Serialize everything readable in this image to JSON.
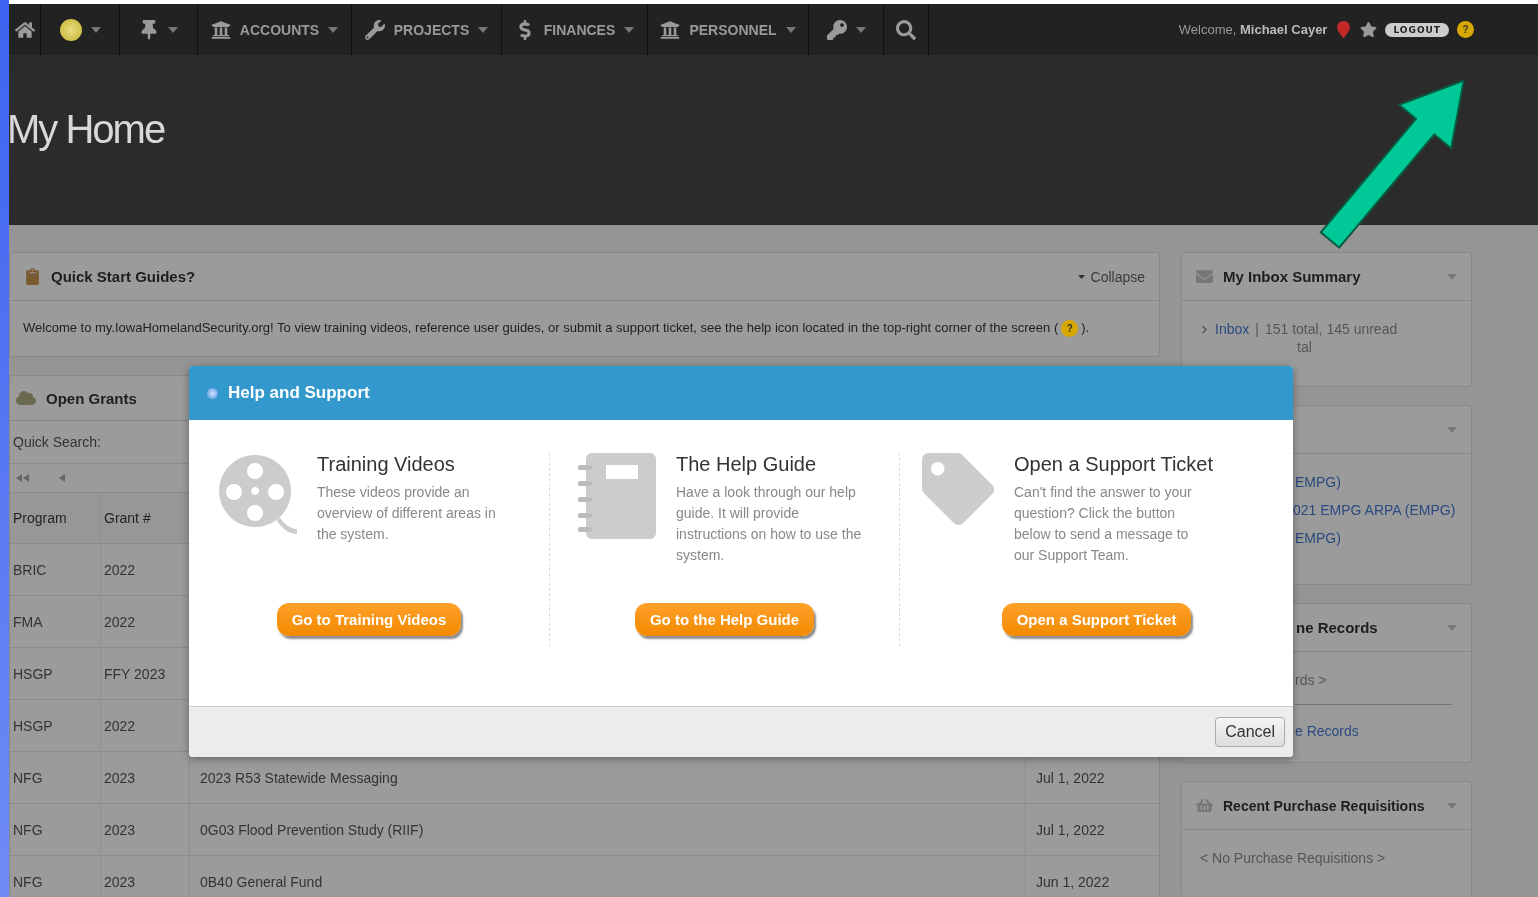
{
  "nav": {
    "items": [
      {
        "kind": "home"
      },
      {
        "kind": "status",
        "dropdown": true
      },
      {
        "kind": "pin",
        "dropdown": true
      },
      {
        "kind": "bank",
        "label": "ACCOUNTS",
        "dropdown": true
      },
      {
        "kind": "wrench",
        "label": "PROJECTS",
        "dropdown": true
      },
      {
        "kind": "dollar",
        "label": "FINANCES",
        "dropdown": true
      },
      {
        "kind": "bank",
        "label": "PERSONNEL",
        "dropdown": true
      },
      {
        "kind": "key",
        "dropdown": true
      },
      {
        "kind": "search"
      }
    ]
  },
  "user": {
    "greeting": "Welcome,",
    "name": "Michael Cayer",
    "logout": "LOGOUT",
    "help": "?"
  },
  "page_title": "My Home",
  "quick_start": {
    "title": "Quick Start Guides?",
    "toggle": "Collapse",
    "text": "Welcome to my.IowaHomelandSecurity.org! To view training videos, reference user guides, or submit a support ticket, see the help icon located in the top-right corner of the screen (",
    "help": "?",
    "text_end": ")."
  },
  "open_grants": {
    "title": "Open Grants",
    "search_label": "Quick Search:",
    "columns": [
      "Program",
      "Grant #"
    ],
    "rows": [
      {
        "program": "BRIC",
        "grant": "2022"
      },
      {
        "program": "FMA",
        "grant": "2022"
      },
      {
        "program": "HSGP",
        "grant": "FFY 2023"
      },
      {
        "program": "HSGP",
        "grant": "2022"
      },
      {
        "program": "NFG",
        "grant": "2023",
        "title": "2023 R53 Statewide Messaging",
        "date": "Jul 1, 2022"
      },
      {
        "program": "NFG",
        "grant": "2023",
        "title": "0G03 Flood Prevention Study (RIIF)",
        "date": "Jul 1, 2022"
      },
      {
        "program": "NFG",
        "grant": "2023",
        "title": "0B40 General Fund",
        "date": "Jun 1, 2022"
      }
    ]
  },
  "inbox": {
    "title": "My Inbox Summary",
    "link": "Inbox",
    "separator": "|",
    "summary": "151 total, 145 unread",
    "cut": "tal"
  },
  "grants_panel": {
    "links": [
      "EMPG)",
      "021 EMPG ARPA (EMPG)",
      "EMPG)"
    ]
  },
  "records_panel": {
    "title": "ne Records",
    "note": "rds >",
    "link": "e Records"
  },
  "requisitions": {
    "title": "Recent Purchase Requisitions",
    "note": "< No Purchase Requisitions >"
  },
  "dialog": {
    "title": "Help and Support",
    "options": [
      {
        "kind": "video",
        "title": "Training Videos",
        "text": "These videos provide an overview of different areas in the system.",
        "button": "Go to Training Videos"
      },
      {
        "kind": "guide",
        "title": "The Help Guide",
        "text": "Have a look through our help guide. It will provide instructions on how to use the system.",
        "button": "Go to the Help Guide"
      },
      {
        "kind": "ticket",
        "title": "Open a Support Ticket",
        "text": "Can't find the answer to your question? Click the button below to send a message to our Support Team.",
        "button": "Open a Support Ticket"
      }
    ],
    "cancel": "Cancel"
  }
}
